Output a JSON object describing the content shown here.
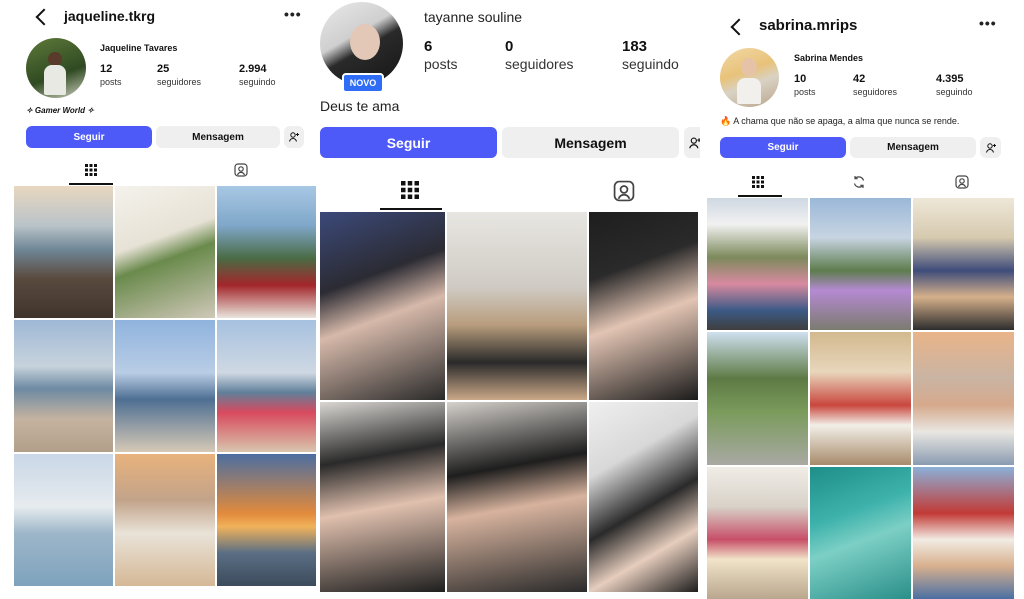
{
  "profiles": [
    {
      "username": "jaqueline.tkrg",
      "full_name": "Jaqueline Tavares",
      "stats": [
        {
          "value": "12",
          "label": "posts"
        },
        {
          "value": "25",
          "label": "seguidores"
        },
        {
          "value": "2.994",
          "label": "seguindo"
        }
      ],
      "bio": "✧ Gamer World ✧",
      "follow_label": "Seguir",
      "message_label": "Mensagem",
      "tabs": [
        "grid-icon",
        "tagged-icon"
      ]
    },
    {
      "username": "tayanne souline",
      "badge": "NOVO",
      "stats": [
        {
          "value": "6",
          "label": "posts"
        },
        {
          "value": "0",
          "label": "seguidores"
        },
        {
          "value": "183",
          "label": "seguindo"
        }
      ],
      "bio": "Deus te ama",
      "follow_label": "Seguir",
      "message_label": "Mensagem",
      "tabs": [
        "grid-icon",
        "tagged-icon"
      ]
    },
    {
      "username": "sabrina.mrips",
      "full_name": "Sabrina Mendes",
      "stats": [
        {
          "value": "10",
          "label": "posts"
        },
        {
          "value": "42",
          "label": "seguidores"
        },
        {
          "value": "4.395",
          "label": "seguindo"
        }
      ],
      "bio": "🔥 A chama que não se apaga, a alma que nunca se rende.",
      "follow_label": "Seguir",
      "message_label": "Mensagem",
      "tabs": [
        "grid-icon",
        "reels-icon",
        "tagged-icon"
      ]
    }
  ],
  "colors": {
    "follow_button": "#4d5af8",
    "secondary_button": "#efefef",
    "text": "#111111"
  }
}
